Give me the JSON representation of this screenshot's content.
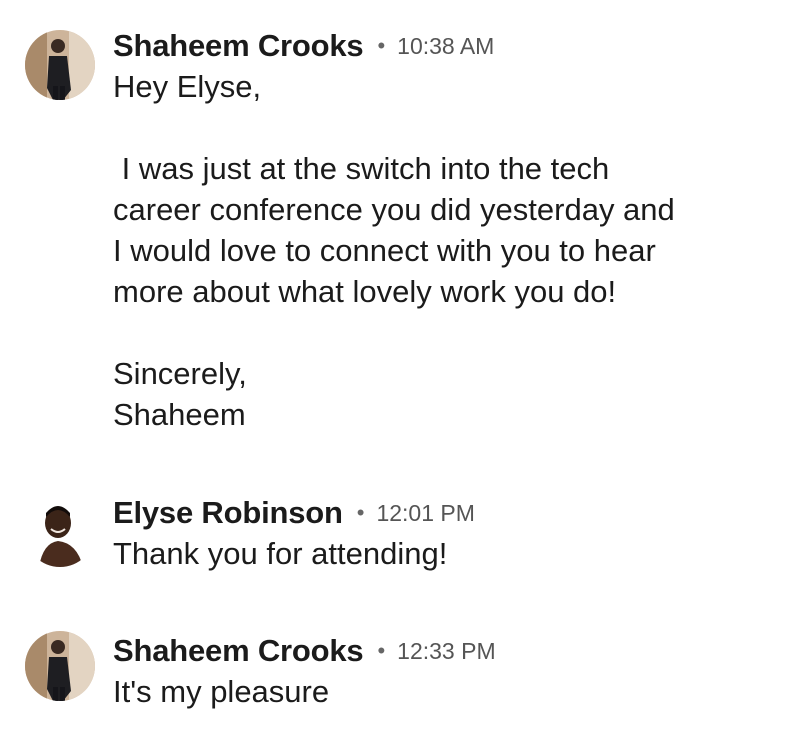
{
  "messages": [
    {
      "sender": "Shaheem Crooks",
      "separator": "•",
      "time": "10:38 AM",
      "lines": [
        "Hey Elyse,",
        "",
        " I was just at the switch into the tech",
        "career conference you did yesterday and",
        "I would love to connect with you to hear",
        "more about what lovely work you do!",
        "",
        "Sincerely,",
        "Shaheem"
      ],
      "avatar_icon": "person-avatar-icon"
    },
    {
      "sender": "Elyse Robinson",
      "separator": "•",
      "time": "12:01 PM",
      "lines": [
        "Thank you for attending!"
      ],
      "avatar_icon": "person-avatar-icon"
    },
    {
      "sender": "Shaheem Crooks",
      "separator": "•",
      "time": "12:33 PM",
      "lines": [
        "It's my pleasure"
      ],
      "avatar_icon": "person-avatar-icon"
    }
  ],
  "colors": {
    "text": "#1b1b1b",
    "time": "#555555",
    "background": "#ffffff"
  }
}
